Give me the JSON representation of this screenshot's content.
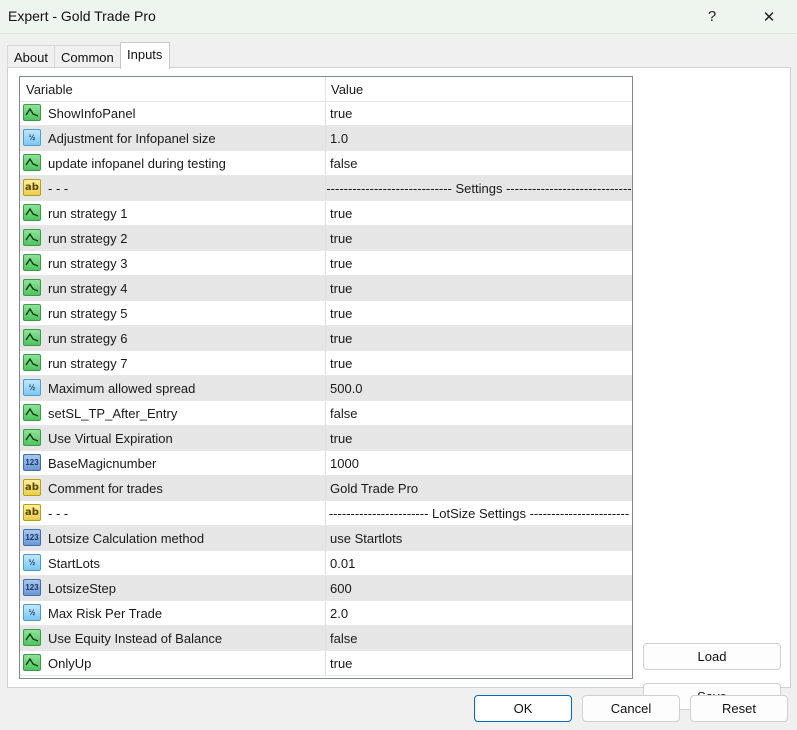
{
  "window": {
    "title": "Expert - Gold Trade Pro",
    "help": "?",
    "close": "✕"
  },
  "tabs": [
    {
      "label": "About"
    },
    {
      "label": "Common"
    },
    {
      "label": "Inputs"
    }
  ],
  "grid": {
    "col_variable": "Variable",
    "col_value": "Value",
    "rows": [
      {
        "type": "bool",
        "variable": "ShowInfoPanel",
        "value": "true"
      },
      {
        "type": "double",
        "variable": "Adjustment for Infopanel size",
        "value": "1.0"
      },
      {
        "type": "bool",
        "variable": "update infopanel during testing",
        "value": "false"
      },
      {
        "type": "string",
        "variable": "- - -",
        "value": "----------------------------- Settings -----------------------------"
      },
      {
        "type": "bool",
        "variable": "run strategy 1",
        "value": "true"
      },
      {
        "type": "bool",
        "variable": "run strategy 2",
        "value": "true"
      },
      {
        "type": "bool",
        "variable": "run strategy 3",
        "value": "true"
      },
      {
        "type": "bool",
        "variable": "run strategy 4",
        "value": "true"
      },
      {
        "type": "bool",
        "variable": "run strategy 5",
        "value": "true"
      },
      {
        "type": "bool",
        "variable": "run strategy 6",
        "value": "true"
      },
      {
        "type": "bool",
        "variable": "run strategy 7",
        "value": "true"
      },
      {
        "type": "double",
        "variable": "Maximum allowed spread",
        "value": "500.0"
      },
      {
        "type": "bool",
        "variable": "setSL_TP_After_Entry",
        "value": "false"
      },
      {
        "type": "bool",
        "variable": "Use Virtual Expiration",
        "value": "true"
      },
      {
        "type": "int",
        "variable": "BaseMagicnumber",
        "value": "1000"
      },
      {
        "type": "string",
        "variable": "Comment for trades",
        "value": "Gold Trade Pro"
      },
      {
        "type": "string",
        "variable": "- - -",
        "value": "----------------------- LotSize Settings -----------------------"
      },
      {
        "type": "int",
        "variable": "Lotsize Calculation method",
        "value": "use Startlots"
      },
      {
        "type": "double",
        "variable": "StartLots",
        "value": "0.01"
      },
      {
        "type": "int",
        "variable": "LotsizeStep",
        "value": "600"
      },
      {
        "type": "double",
        "variable": "Max Risk Per Trade",
        "value": "2.0"
      },
      {
        "type": "bool",
        "variable": "Use Equity Instead of Balance",
        "value": "false"
      },
      {
        "type": "bool",
        "variable": "OnlyUp",
        "value": "true"
      }
    ]
  },
  "side_buttons": {
    "load": "Load",
    "save": "Save"
  },
  "footer": {
    "ok": "OK",
    "cancel": "Cancel",
    "reset": "Reset"
  },
  "icons": {
    "bool": "boolean-icon",
    "double": "double-icon",
    "int": "integer-icon",
    "string": "string-icon",
    "double_glyph": "½",
    "int_glyph": "123",
    "string_glyph": "ab"
  }
}
